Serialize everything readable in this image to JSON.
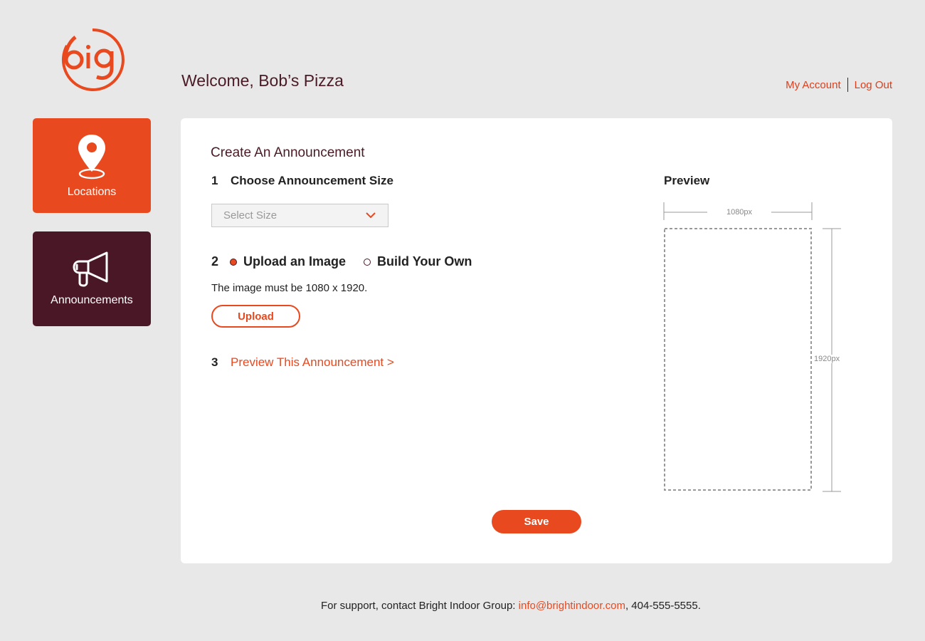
{
  "brand": {
    "logo_text": "big",
    "accent": "#e8491f",
    "dark": "#4a1726"
  },
  "header": {
    "welcome": "Welcome, Bob’s Pizza",
    "my_account": "My Account",
    "log_out": "Log Out"
  },
  "sidebar": {
    "items": [
      {
        "label": "Locations",
        "icon": "location-pin-icon",
        "color": "#e8491f"
      },
      {
        "label": "Announcements",
        "icon": "megaphone-icon",
        "color": "#4a1726"
      }
    ]
  },
  "form": {
    "title": "Create An Announcement",
    "step1": {
      "number": "1",
      "label": "Choose Announcement Size",
      "select_placeholder": "Select Size"
    },
    "step2": {
      "number": "2",
      "option_upload": "Upload an Image",
      "option_build": "Build Your Own",
      "selected": "Upload an Image",
      "hint": "The image must be 1080 x 1920.",
      "upload_label": "Upload"
    },
    "step3": {
      "number": "3",
      "link": "Preview This Announcement >"
    },
    "save_label": "Save"
  },
  "preview": {
    "title": "Preview",
    "width_label": "1080px",
    "height_label": "1920px"
  },
  "footer": {
    "prefix": "For support, contact Bright Indoor Group: ",
    "email": "info@brightindoor.com",
    "suffix": ", 404-555-5555."
  }
}
